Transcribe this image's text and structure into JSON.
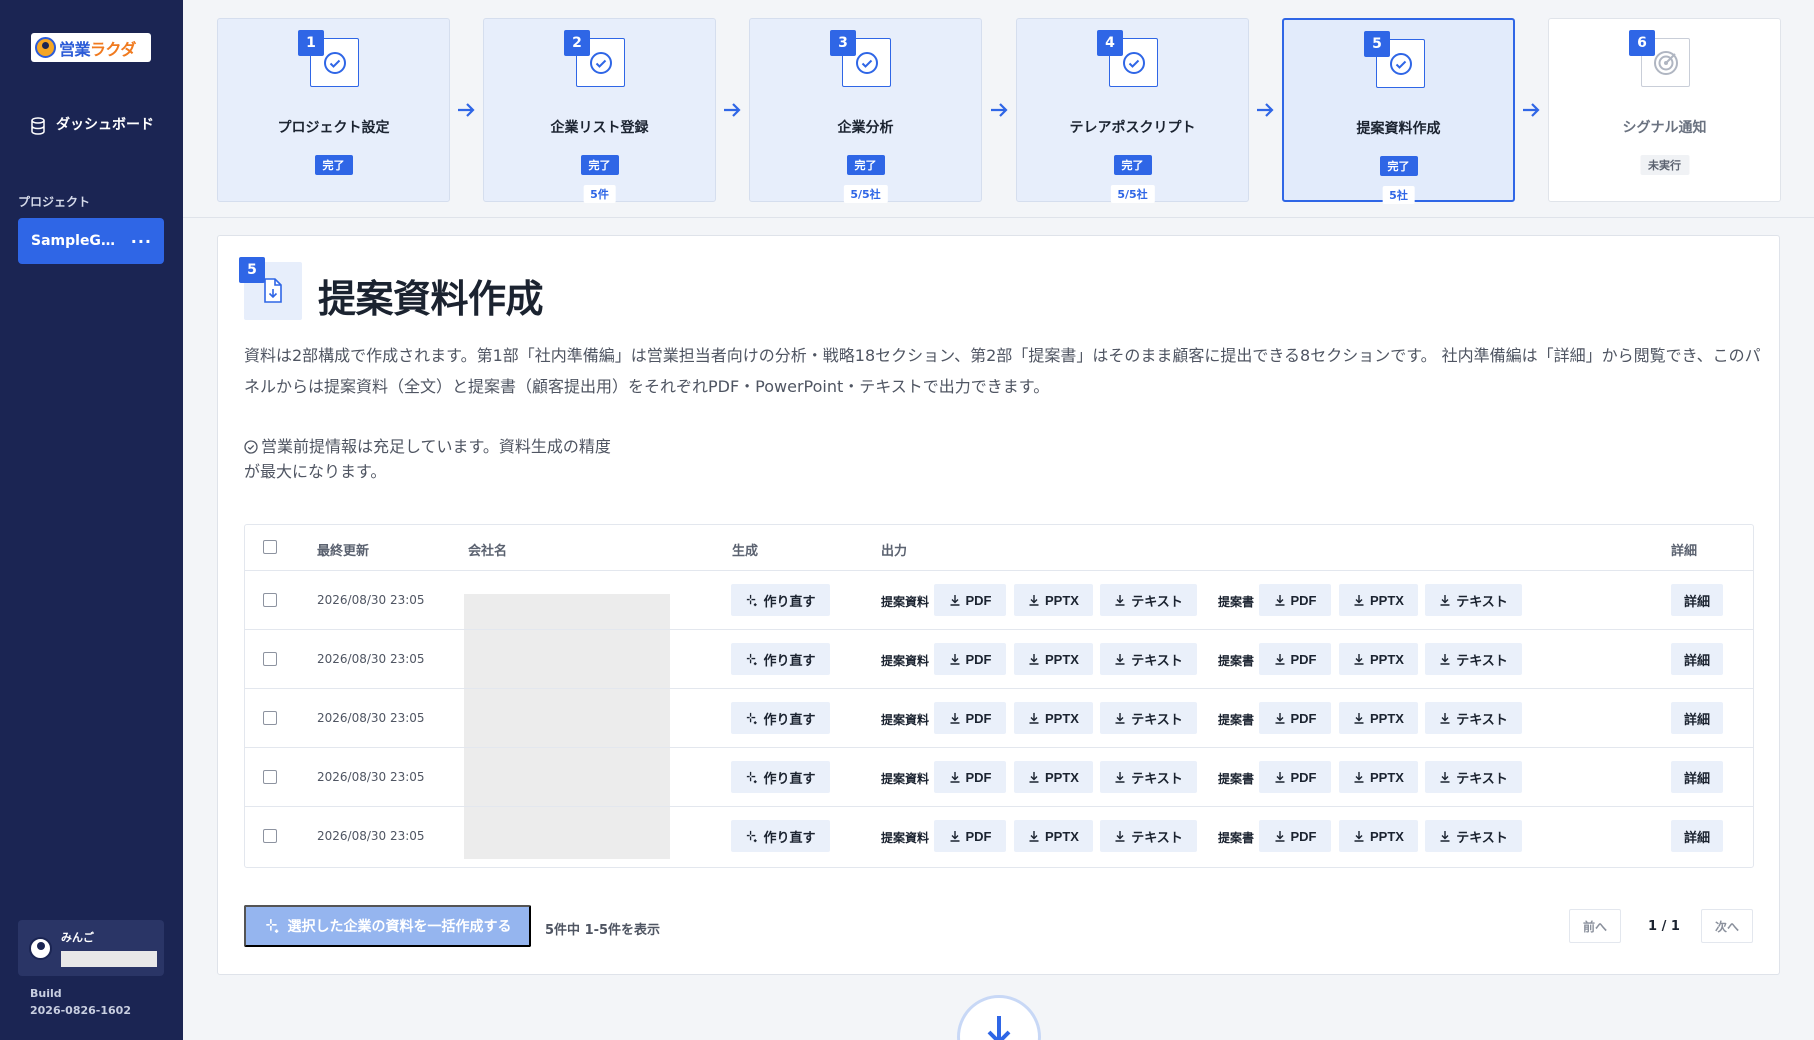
{
  "sidebar": {
    "logo_main": "営業",
    "logo_accent": "ラクダ",
    "nav_dashboard": "ダッシュボード",
    "section_label": "プロジェクト",
    "project_name": "SampleGi…",
    "project_more": "···",
    "user_name": "みんご",
    "build_label": "Build",
    "build_version": "2026-0826-1602"
  },
  "steps": [
    {
      "num": "1",
      "title": "プロジェクト設定",
      "badge": "完了",
      "count": ""
    },
    {
      "num": "2",
      "title": "企業リスト登録",
      "badge": "完了",
      "count": "5件"
    },
    {
      "num": "3",
      "title": "企業分析",
      "badge": "完了",
      "count": "5/5社"
    },
    {
      "num": "4",
      "title": "テレアポスクリプト",
      "badge": "完了",
      "count": "5/5社"
    },
    {
      "num": "5",
      "title": "提案資料作成",
      "badge": "完了",
      "count": "5社"
    },
    {
      "num": "6",
      "title": "シグナル通知",
      "badge": "未実行",
      "count": ""
    }
  ],
  "panel": {
    "num": "5",
    "title": "提案資料作成",
    "description": "資料は2部構成で作成されます。第1部「社内準備編」は営業担当者向けの分析・戦略18セクション、第2部「提案書」はそのまま顧客に提出できる8セクションです。 社内準備編は「詳細」から閲覧でき、このパネルからは提案資料（全文）と提案書（顧客提出用）をそれぞれPDF・PowerPoint・テキストで出力できます。",
    "notice": "営業前提情報は充足しています。資料生成の精度が最大になります。"
  },
  "table": {
    "headers": {
      "updated": "最終更新",
      "company": "会社名",
      "generate": "生成",
      "output": "出力",
      "detail": "詳細"
    },
    "rows": [
      {
        "updated": "2026/08/30 23:05"
      },
      {
        "updated": "2026/08/30 23:05"
      },
      {
        "updated": "2026/08/30 23:05"
      },
      {
        "updated": "2026/08/30 23:05"
      },
      {
        "updated": "2026/08/30 23:05"
      }
    ],
    "labels": {
      "regen": "作り直す",
      "group1": "提案資料",
      "group2": "提案書",
      "pdf": "PDF",
      "pptx": "PPTX",
      "text": "テキスト",
      "detail": "詳細"
    }
  },
  "footer": {
    "bulk_button": "選択した企業の資料を一括作成する",
    "count_text": "5件中 1-5件を表示",
    "prev": "前へ",
    "page_indicator": "1 / 1",
    "next": "次へ"
  },
  "colors": {
    "sidebar_bg": "#1b2553",
    "accent": "#2f66e6",
    "step_bg": "#e7eefb",
    "button_bg": "#eaf0fa"
  }
}
